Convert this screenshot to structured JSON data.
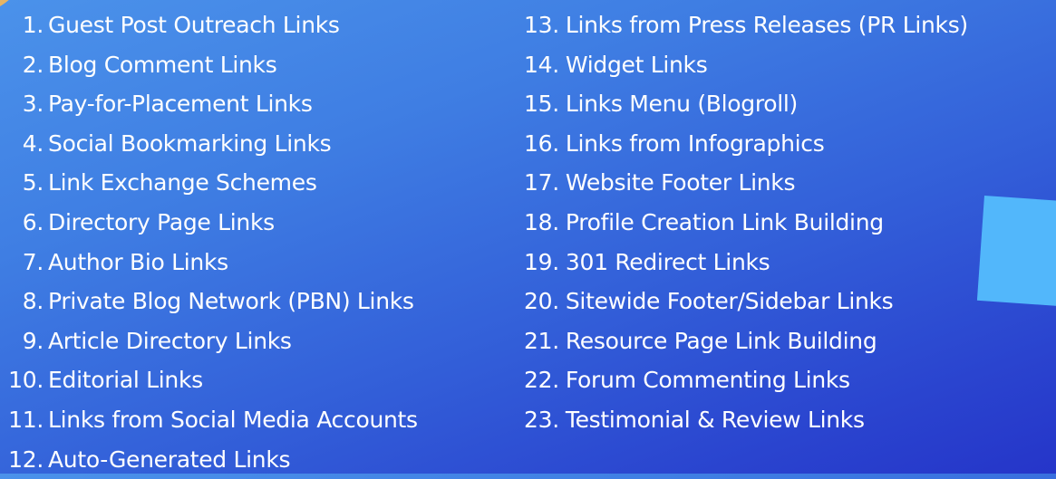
{
  "colors": {
    "background_start": "#4b92ea",
    "background_end": "#2535c9",
    "text": "#ffffff",
    "corner_accent": "#e6b463",
    "square_accent": "#52b7fb"
  },
  "left_column": [
    {
      "num": "1.",
      "label": "Guest Post Outreach Links"
    },
    {
      "num": "2.",
      "label": "Blog Comment Links"
    },
    {
      "num": "3.",
      "label": "Pay-for-Placement Links"
    },
    {
      "num": "4.",
      "label": "Social Bookmarking Links"
    },
    {
      "num": "5.",
      "label": "Link Exchange Schemes"
    },
    {
      "num": "6.",
      "label": "Directory Page Links"
    },
    {
      "num": "7.",
      "label": "Author Bio Links"
    },
    {
      "num": "8.",
      "label": "Private Blog Network (PBN) Links"
    },
    {
      "num": "9.",
      "label": "Article Directory Links"
    },
    {
      "num": "10.",
      "label": "Editorial Links"
    },
    {
      "num": "11.",
      "label": "Links from Social Media Accounts"
    },
    {
      "num": "12.",
      "label": "Auto-Generated Links"
    }
  ],
  "right_column": [
    {
      "num": "13.",
      "label": "Links from Press Releases (PR Links)"
    },
    {
      "num": "14.",
      "label": "Widget Links"
    },
    {
      "num": "15.",
      "label": "Links Menu (Blogroll)"
    },
    {
      "num": "16.",
      "label": "Links from Infographics"
    },
    {
      "num": "17.",
      "label": "Website Footer Links"
    },
    {
      "num": "18.",
      "label": "Profile Creation Link Building"
    },
    {
      "num": "19.",
      "label": "301 Redirect Links"
    },
    {
      "num": "20.",
      "label": "Sitewide Footer/Sidebar Links"
    },
    {
      "num": "21.",
      "label": "Resource Page Link Building"
    },
    {
      "num": "22.",
      "label": "Forum Commenting Links"
    },
    {
      "num": "23.",
      "label": "Testimonial & Review Links"
    }
  ]
}
